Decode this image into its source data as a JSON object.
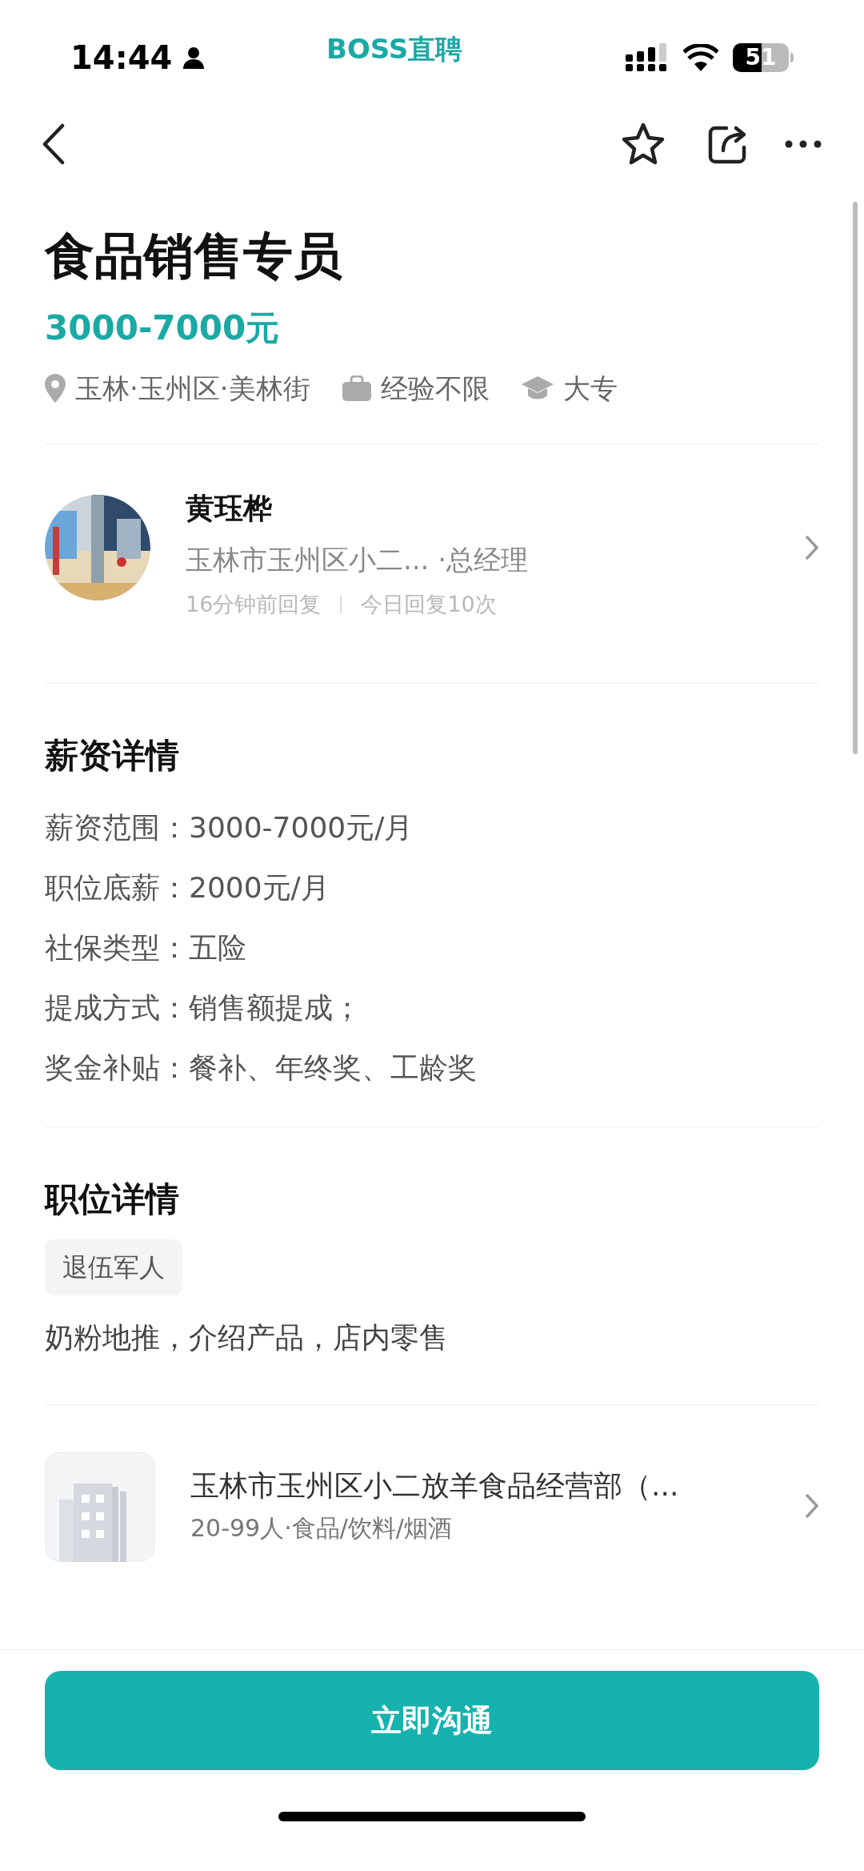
{
  "status_bar": {
    "time": "14:44",
    "app": "BOSS直聘",
    "battery": "51"
  },
  "job": {
    "title": "食品销售专员",
    "salary": "3000-7000元",
    "tags": [
      {
        "kind": "location",
        "text": "玉林·玉州区·美林街"
      },
      {
        "kind": "experience",
        "text": "经验不限"
      },
      {
        "kind": "education",
        "text": "大专"
      }
    ]
  },
  "recruiter": {
    "name": "黄珏桦",
    "company_role": "玉林市玉州区小二... ·总经理",
    "reply_time": "16分钟前回复",
    "reply_count": "今日回复10次"
  },
  "salary_details": {
    "heading": "薪资详情",
    "lines": [
      "薪资范围：3000-7000元/月",
      "职位底薪：2000元/月",
      "社保类型：五险",
      "提成方式：销售额提成；",
      "奖金补贴：餐补、年终奖、工龄奖"
    ]
  },
  "job_details": {
    "heading": "职位详情",
    "tags": [
      "退伍军人"
    ],
    "description": "奶粉地推，介绍产品，店内零售"
  },
  "company": {
    "name": "玉林市玉州区小二放羊食品经营部（...",
    "info": "20-99人·食品/饮料/烟酒"
  },
  "action_button": "立即沟通"
}
